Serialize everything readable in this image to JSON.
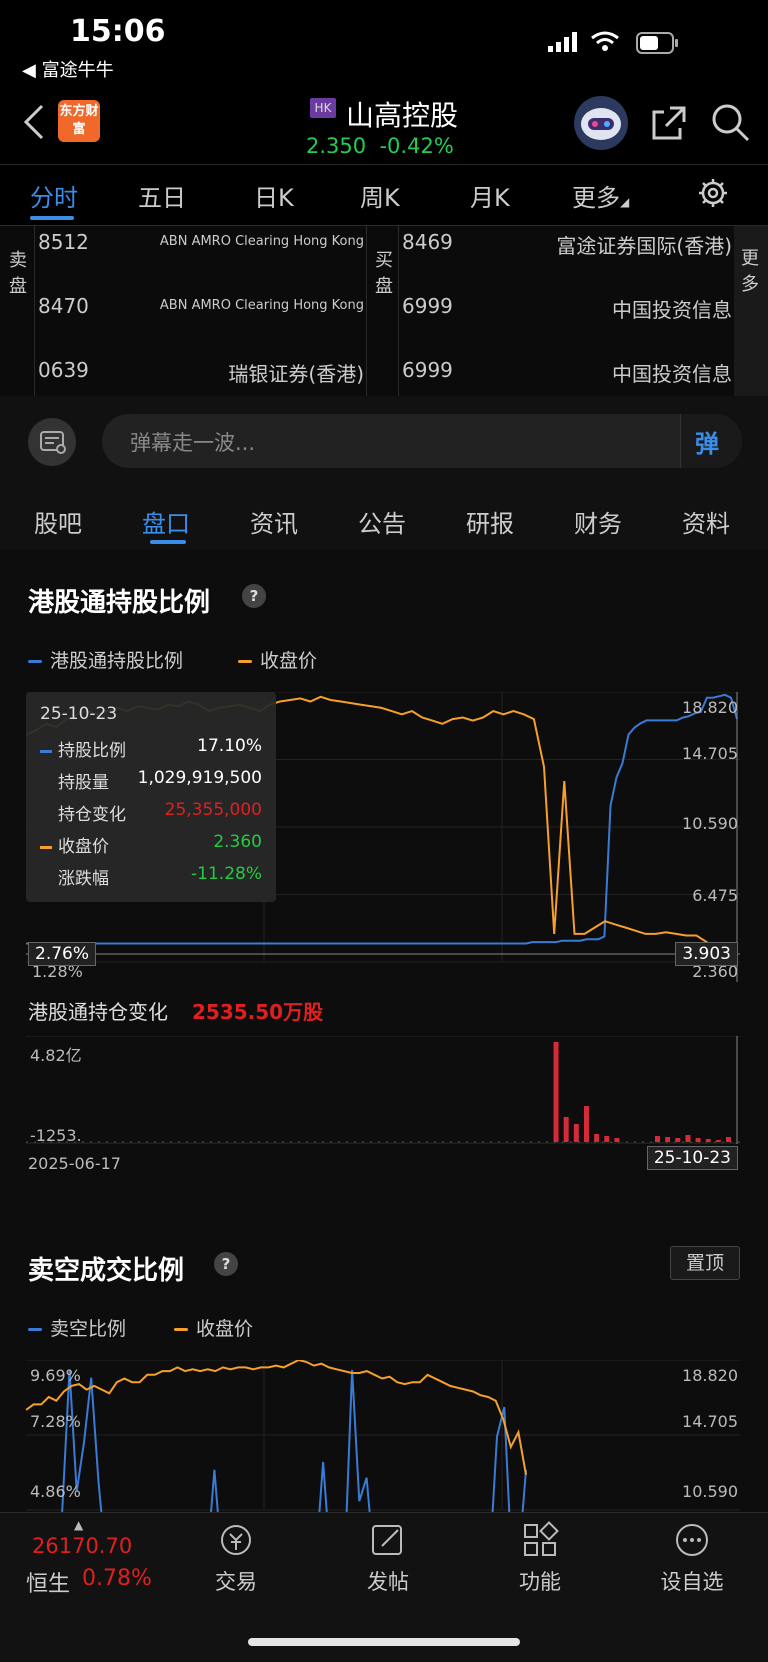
{
  "status": {
    "time": "15:06",
    "back_app": "富途牛牛"
  },
  "header": {
    "app_logo_text": "东方财富",
    "market_badge": "HK",
    "stock_name": "山高控股",
    "price": "2.350",
    "change_pct": "-0.42%"
  },
  "chart_tabs": [
    "分时",
    "五日",
    "日K",
    "周K",
    "月K",
    "更多"
  ],
  "brokers": {
    "sell_label": "卖盘",
    "buy_label": "买盘",
    "more_label": "更多",
    "sell": [
      {
        "code": "8512",
        "name": "ABN AMRO Clearing Hong Kong"
      },
      {
        "code": "8470",
        "name": "ABN AMRO Clearing Hong Kong"
      },
      {
        "code": "0639",
        "name": "瑞银证券(香港)"
      }
    ],
    "buy": [
      {
        "code": "8469",
        "name": "富途证券国际(香港)"
      },
      {
        "code": "6999",
        "name": "中国投资信息"
      },
      {
        "code": "6999",
        "name": "中国投资信息"
      }
    ]
  },
  "danmu": {
    "placeholder": "弹幕走一波...",
    "send_label": "弹"
  },
  "nav2": [
    "股吧",
    "盘口",
    "资讯",
    "公告",
    "研报",
    "财务",
    "资料"
  ],
  "section1": {
    "title": "港股通持股比例",
    "legend": [
      "港股通持股比例",
      "收盘价"
    ],
    "right_axis": [
      "18.820",
      "14.705",
      "10.590",
      "6.475",
      "2.360"
    ],
    "left_axis_partial": [
      "1.28%"
    ],
    "crosshair_left": "2.76%",
    "crosshair_right": "3.903",
    "tooltip": {
      "date": "25-10-23",
      "rows": [
        {
          "label": "持股比例",
          "value": "17.10%",
          "color": "#ffffff"
        },
        {
          "label": "持股量",
          "value": "1,029,919,500",
          "color": "#ffffff"
        },
        {
          "label": "持仓变化",
          "value": "25,355,000",
          "color": "#e02020"
        },
        {
          "label": "收盘价",
          "value": "2.360",
          "color": "#22cc44"
        },
        {
          "label": "涨跌幅",
          "value": "-11.28%",
          "color": "#22cc44"
        }
      ]
    },
    "change_title": "港股通持仓变化",
    "change_value": "2535.50万股",
    "bar_axis_top": "4.82亿",
    "bar_axis_bottom": "-1253.",
    "date_start": "2025-06-17",
    "date_end": "25-10-23"
  },
  "section2": {
    "title": "卖空成交比例",
    "pin_label": "置顶",
    "legend": [
      "卖空比例",
      "收盘价"
    ],
    "left_axis": [
      "9.69%",
      "7.28%",
      "4.86%"
    ],
    "right_axis": [
      "18.820",
      "14.705",
      "10.590"
    ]
  },
  "bottom": {
    "hsi_value": "26170.70",
    "hsi_name": "恒生",
    "hsi_change": "0.78%",
    "items": [
      "交易",
      "发帖",
      "功能",
      "设自选"
    ]
  },
  "chart_data": [
    {
      "type": "line",
      "title": "港股通持股比例",
      "series": [
        {
          "name": "港股通持股比例",
          "unit": "%",
          "values": [
            1.3,
            1.3,
            1.3,
            1.3,
            1.3,
            1.3,
            1.3,
            1.3,
            1.3,
            1.3,
            1.3,
            1.3,
            1.3,
            1.3,
            1.3,
            1.3,
            1.3,
            1.3,
            1.3,
            1.3,
            1.3,
            1.3,
            1.3,
            1.3,
            1.3,
            1.3,
            1.3,
            1.3,
            1.3,
            1.3,
            1.3,
            1.3,
            1.3,
            1.3,
            1.3,
            1.3,
            1.3,
            1.3,
            1.3,
            1.3,
            1.3,
            1.3,
            1.3,
            1.3,
            1.3,
            1.3,
            1.3,
            1.3,
            1.3,
            1.3,
            1.3,
            1.3,
            1.3,
            1.3,
            1.3,
            1.3,
            1.3,
            1.3,
            1.3,
            1.3,
            1.3,
            1.3,
            1.3,
            1.3,
            1.3,
            1.3,
            1.3,
            1.3,
            1.3,
            1.3,
            1.3,
            1.3,
            1.3,
            1.3,
            1.3,
            1.3,
            1.3,
            1.3,
            1.3,
            1.3,
            1.3,
            1.3,
            1.3,
            1.3,
            1.4,
            1.4,
            1.4,
            1.4,
            1.4,
            1.5,
            1.5,
            1.5,
            1.5,
            1.6,
            1.6,
            1.6,
            1.8,
            11,
            13,
            14,
            16,
            16.5,
            16.8,
            17,
            17,
            17,
            17,
            17,
            17,
            17.2,
            17.3,
            17.5,
            17.6,
            18.6,
            18.6,
            18.7,
            18.8,
            18.6,
            17.1
          ]
        },
        {
          "name": "收盘价",
          "unit": "HKD",
          "values": [
            16.5,
            16.8,
            17.2,
            17.0,
            17.5,
            17.8,
            18.0,
            17.8,
            18.0,
            18.2,
            18.0,
            18.3,
            18.2,
            18.1,
            18.4,
            18.3,
            18.6,
            18.4,
            18.0,
            18.2,
            18.3,
            18.4,
            18.2,
            18.0,
            18.4,
            18.6,
            18.7,
            18.8,
            18.6,
            18.9,
            18.7,
            18.6,
            18.5,
            18.4,
            18.3,
            18.2,
            18.0,
            17.8,
            18.0,
            17.6,
            17.4,
            17.2,
            17.5,
            17.6,
            17.4,
            17.6,
            18.0,
            17.8,
            18.0,
            17.8,
            17.5,
            14.5,
            4.0,
            13.6,
            4.0,
            4.0,
            4.4,
            4.8,
            4.6,
            4.4,
            4.2,
            4.0,
            4.0,
            4.1,
            4.0,
            3.9,
            3.9,
            3.5,
            3.0,
            2.9,
            2.36
          ]
        }
      ],
      "right_ylim": [
        2.36,
        18.82
      ]
    },
    {
      "type": "bar",
      "title": "港股通持仓变化",
      "ylim_label_top": "4.82亿",
      "values_relative": [
        0,
        0,
        0,
        0,
        0,
        0,
        0,
        0,
        0,
        0,
        0,
        0,
        0,
        0,
        0,
        0,
        0,
        0,
        0,
        0,
        0,
        0,
        0,
        0,
        0,
        0,
        0,
        0,
        0,
        0,
        0,
        0,
        0,
        0,
        0,
        0,
        0,
        0,
        0,
        0,
        0,
        0,
        0,
        0,
        0,
        0,
        0,
        0,
        0,
        0,
        0,
        0,
        1.0,
        0.25,
        0.18,
        0.36,
        0.08,
        0.06,
        0.04,
        0,
        0,
        0,
        0.06,
        0.05,
        0.04,
        0.07,
        0.04,
        0.03,
        0.02,
        0.05
      ]
    },
    {
      "type": "line",
      "title": "卖空成交比例",
      "series": [
        {
          "name": "卖空比例",
          "unit": "%",
          "values": [
            0,
            0,
            0,
            0,
            0,
            2.5,
            9.7,
            3.5,
            6.0,
            9.3,
            4.0,
            0,
            0,
            0,
            0,
            0,
            0,
            0,
            0,
            0,
            0,
            0,
            0,
            0,
            0,
            0,
            4.6,
            0,
            0,
            0,
            0,
            0,
            0,
            0,
            0,
            0,
            0,
            0,
            0,
            0,
            0,
            5.0,
            0,
            0,
            0,
            9.7,
            3.0,
            4.2,
            0,
            0,
            0,
            0,
            0,
            0,
            0,
            0,
            0,
            0,
            0,
            0,
            0,
            0,
            0,
            0,
            0,
            6.3,
            7.8,
            0,
            0,
            4.6
          ]
        },
        {
          "name": "收盘价",
          "unit": "HKD",
          "values": [
            16.5,
            16.8,
            16.8,
            17.2,
            17.0,
            17.5,
            17.8,
            17.9,
            17.6,
            17.8,
            17.6,
            17.4,
            18.0,
            18.2,
            18.0,
            18.0,
            18.4,
            18.4,
            18.6,
            18.6,
            18.8,
            18.6,
            18.7,
            18.6,
            18.7,
            18.6,
            18.8,
            18.7,
            18.8,
            18.8,
            18.7,
            18.8,
            18.8,
            18.9,
            18.8,
            19.0,
            19.2,
            19.1,
            18.9,
            19.0,
            18.8,
            18.7,
            18.6,
            18.5,
            18.5,
            18.6,
            18.4,
            18.2,
            18.3,
            18.0,
            17.9,
            18.0,
            18.0,
            18.4,
            18.2,
            18.0,
            17.8,
            17.7,
            17.6,
            17.5,
            17.3,
            17.2,
            17.0,
            16.0,
            14.5,
            15.3,
            13.0
          ]
        }
      ],
      "left_ylim": [
        0,
        9.69
      ],
      "right_ylim": [
        2.36,
        18.82
      ]
    }
  ],
  "colors": {
    "accent": "#3a8ee8",
    "up": "#e02020",
    "down": "#22cc44",
    "price_line": "#f5a02a",
    "holding_line": "#3a7bd5"
  }
}
